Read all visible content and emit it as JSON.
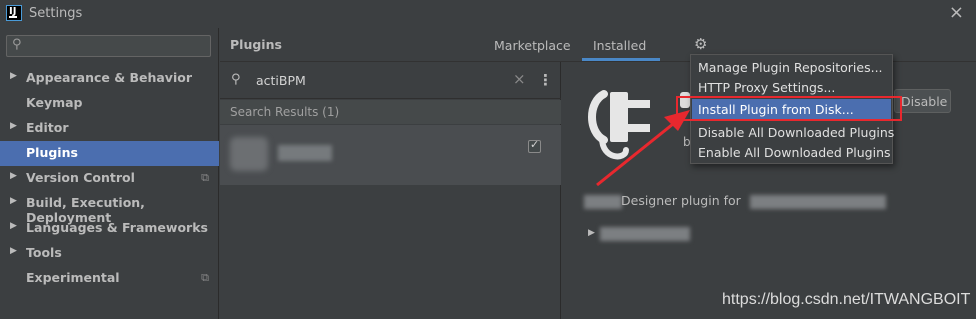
{
  "window": {
    "title": "Settings"
  },
  "search": {
    "placeholder": ""
  },
  "sidebar": {
    "items": [
      {
        "label": "Appearance & Behavior"
      },
      {
        "label": "Keymap"
      },
      {
        "label": "Editor"
      },
      {
        "label": "Plugins"
      },
      {
        "label": "Version Control"
      },
      {
        "label": "Build, Execution, Deployment"
      },
      {
        "label": "Languages & Frameworks"
      },
      {
        "label": "Tools"
      },
      {
        "label": "Experimental"
      }
    ],
    "selected": "Plugins"
  },
  "header": {
    "title": "Plugins",
    "tabs": [
      {
        "label": "Marketplace"
      },
      {
        "label": "Installed"
      }
    ],
    "active_tab": "Installed"
  },
  "plugin_search": {
    "query": "actiBPM"
  },
  "results": {
    "header": "Search Results (1)"
  },
  "detail": {
    "disable_label": "Disable",
    "name_fragment": "b",
    "description": "Designer plugin for"
  },
  "menu": {
    "items": [
      {
        "label": "Manage Plugin Repositories..."
      },
      {
        "label": "HTTP Proxy Settings..."
      },
      {
        "label": "Install Plugin from Disk..."
      },
      {
        "label": "Disable All Downloaded Plugins"
      },
      {
        "label": "Enable All Downloaded Plugins"
      }
    ],
    "selected": "Install Plugin from Disk..."
  },
  "watermark": "https://blog.csdn.net/ITWANGBOIT",
  "colors": {
    "background": "#3c3f41",
    "selection": "#4b6eaf",
    "annotation": "#e8282e",
    "tab_underline": "#4a88c7"
  }
}
